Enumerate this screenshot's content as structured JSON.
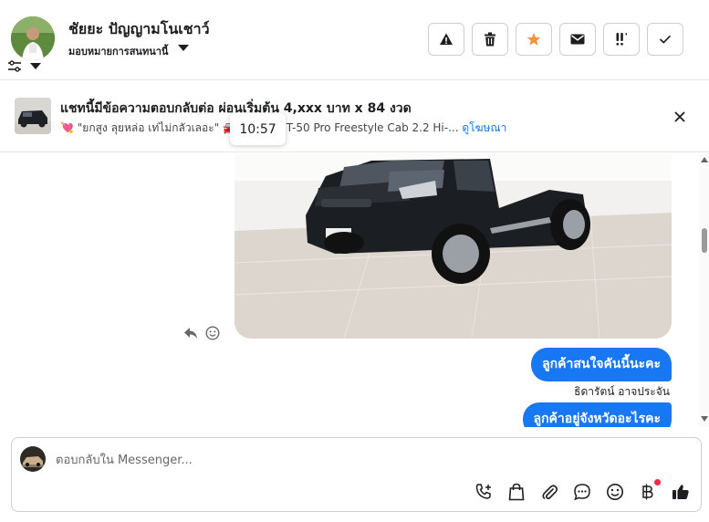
{
  "header": {
    "contact_name": "ชัยยะ ปัญญามโนเชาว์",
    "assignee": "มอบหมายการสนทนานี้",
    "buttons": [
      {
        "name": "mark-spam-button",
        "icon": "alert-triangle-icon"
      },
      {
        "name": "delete-button",
        "icon": "trash-icon"
      },
      {
        "name": "star-button",
        "icon": "star-icon",
        "color": "#f7923a"
      },
      {
        "name": "mark-unread-button",
        "icon": "envelope-icon"
      },
      {
        "name": "follow-up-button",
        "icon": "exclamation-icon"
      },
      {
        "name": "mark-done-button",
        "icon": "check-icon"
      }
    ]
  },
  "ad": {
    "title": "แชทนี้มีข้อความตอบกลับต่อ ผ่อนเริ่มต้น 4,xxx บาท x 84 งวด",
    "subtitle_text": "\"ยกสูง ลุยหล่อ เท่ไม่กลัวเลอะ\" 🚘 Mazda BT-50 Pro Freestyle Cab 2.2 Hi-...",
    "link": "ดูโฆษณา",
    "timestamp": "10:57"
  },
  "messages": {
    "outgoing": [
      {
        "text": "ลูกค้าสนใจคันนี้นะคะ"
      },
      {
        "text": "ลูกค้าอยู่จังหวัดอะไรคะ"
      }
    ],
    "sender": "ธิดารัตน์ อาจประจัน"
  },
  "composer": {
    "placeholder": "ตอบกลับใน Messenger...",
    "tools": [
      "call-add-icon",
      "shopping-bag-icon",
      "paperclip-icon",
      "saved-reply-icon",
      "emoji-icon",
      "baht-icon",
      "thumbs-up-icon"
    ]
  },
  "colors": {
    "accent": "#1877f2",
    "star": "#f7923a",
    "notification": "#f02849"
  }
}
